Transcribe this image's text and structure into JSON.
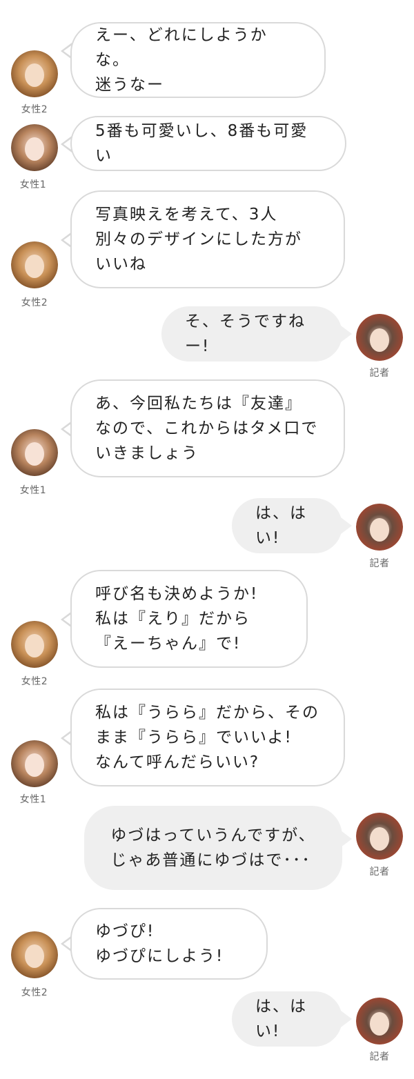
{
  "names": {
    "f2": "女性2",
    "f1": "女性1",
    "rep": "記者"
  },
  "messages": [
    {
      "text": "えー、どれにしようかな。\n迷うなー"
    },
    {
      "text": "5番も可愛いし、8番も可愛い"
    },
    {
      "text": "写真映えを考えて、3人\n別々のデザインにした方が\nいいね"
    },
    {
      "text": "そ、そうですねー!"
    },
    {
      "text": "あ、今回私たちは『友達』\nなので、これからはタメ口で\nいきましょう"
    },
    {
      "text": "は、はい!"
    },
    {
      "text": "呼び名も決めようか!\n私は『えり』だから\n『えーちゃん』で!"
    },
    {
      "text": "私は『うらら』だから、その\nまま『うらら』でいいよ!\nなんて呼んだらいい?"
    },
    {
      "text": "ゆづはっていうんですが、\nじゃあ普通にゆづはで･･･"
    },
    {
      "text": "ゆづぴ!\nゆづぴにしよう!"
    },
    {
      "text": "は、はい!"
    }
  ]
}
